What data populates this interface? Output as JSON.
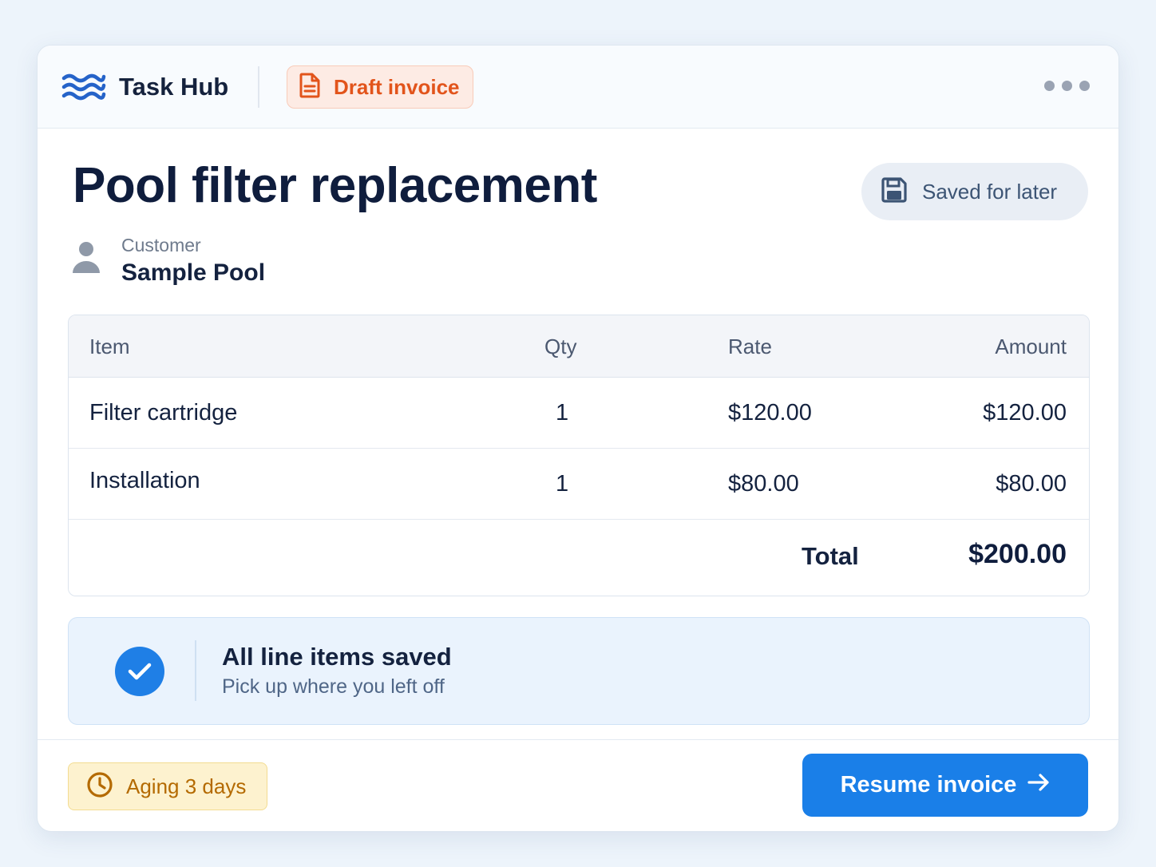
{
  "header": {
    "brand_name": "Task Hub",
    "brand_icon": "waves-icon",
    "draft_badge": {
      "label": "Draft invoice",
      "icon": "document-icon",
      "color": "#e2541b"
    },
    "more_icon": "more-dots-icon"
  },
  "invoice": {
    "title": "Pool filter replacement",
    "saved_status": {
      "label": "Saved for later",
      "icon": "save-icon"
    },
    "customer": {
      "label": "Customer",
      "name": "Sample Pool",
      "icon": "user-icon"
    }
  },
  "table": {
    "columns": [
      "Item",
      "Qty",
      "Rate",
      "Amount"
    ],
    "rows": [
      {
        "item": "Filter cartridge",
        "qty": "1",
        "rate": "$120.00",
        "amount": "$120.00"
      },
      {
        "item": "Installation",
        "qty": "1",
        "rate": "$80.00",
        "amount": "$80.00"
      }
    ],
    "total_label": "Total",
    "total_value": "$200.00"
  },
  "status": {
    "title": "All line items saved",
    "subtitle": "Pick up where you left off",
    "icon": "check-icon"
  },
  "footer": {
    "aging_label": "Aging 3 days",
    "aging_icon": "clock-icon",
    "resume_label": "Resume invoice",
    "resume_icon": "arrow-right-icon"
  },
  "colors": {
    "primary": "#1a7fe8",
    "draft": "#e2541b",
    "aging": "#b46a00",
    "brand": "#2563c9"
  }
}
